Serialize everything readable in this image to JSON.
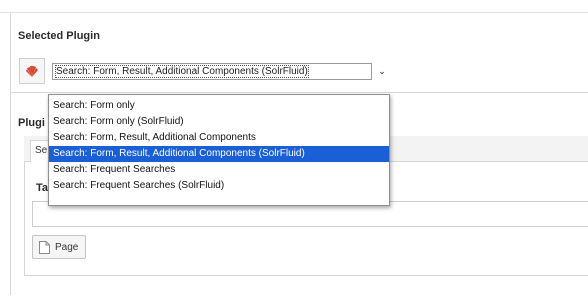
{
  "selected_plugin": {
    "section_title": "Selected Plugin",
    "icon": "solr-plugin-icon",
    "select_value": "Search: Form, Result, Additional Components (SolrFluid)",
    "dropdown_arrow": "⌄",
    "options": [
      "Search: Form only",
      "Search: Form only (SolrFluid)",
      "Search: Form, Result, Additional Components",
      "Search: Form, Result, Additional Components (SolrFluid)",
      "Search: Frequent Searches",
      "Search: Frequent Searches (SolrFluid)"
    ],
    "selected_index": 3,
    "highlight_color": "#1a5fd6"
  },
  "plugin_options": {
    "label_partial": "Plugi",
    "tab_label_partial": "Se",
    "field_label_partial": "Ta",
    "page_button_label": "Page",
    "page_button_icon": "page-icon"
  }
}
